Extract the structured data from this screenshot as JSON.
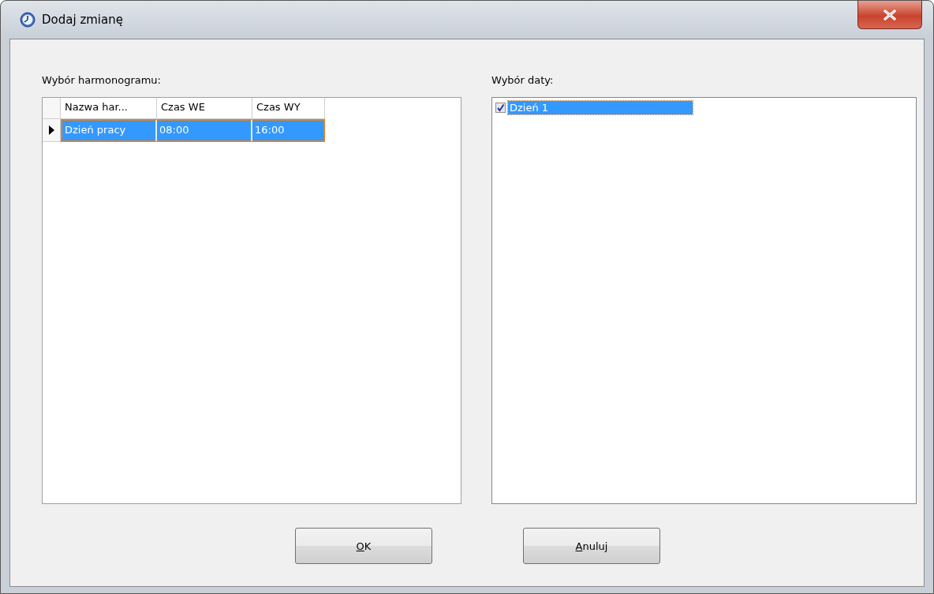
{
  "window": {
    "title": "Dodaj zmianę"
  },
  "schedule": {
    "label": "Wybór harmonogramu:",
    "columns": [
      "Nazwa har...",
      "Czas WE",
      "Czas WY"
    ],
    "rows": [
      {
        "cells": [
          "Dzień pracy",
          "08:00",
          "16:00"
        ],
        "selected": true,
        "current": true
      }
    ]
  },
  "dates": {
    "label": "Wybór daty:",
    "items": [
      {
        "label": "Dzień 1",
        "checked": true,
        "selected": true
      }
    ]
  },
  "buttons": [
    {
      "label": "OK"
    },
    {
      "label": "Anuluj"
    }
  ]
}
